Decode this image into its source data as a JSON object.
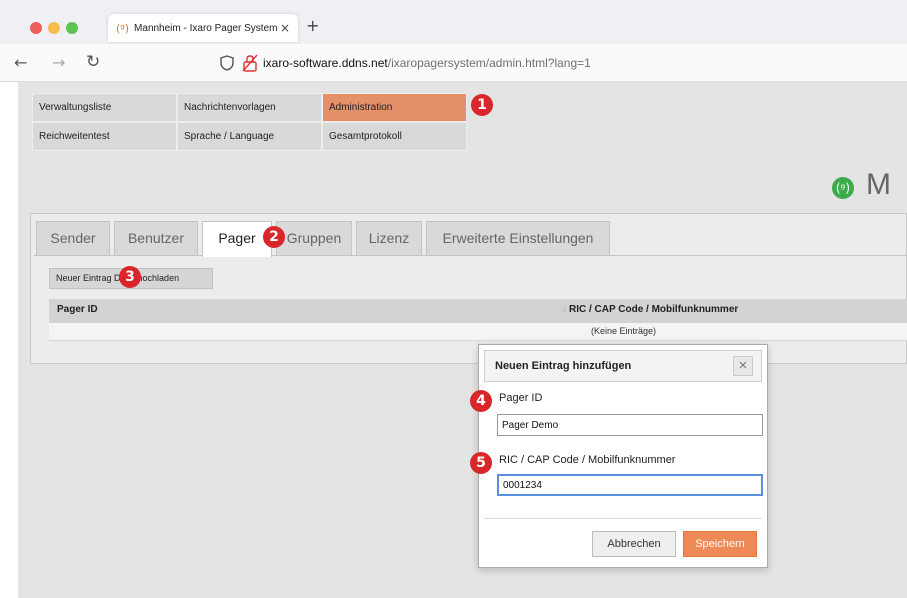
{
  "browser": {
    "tab_title": "Mannheim - Ixaro Pager System",
    "tab_icon": "(ᵍ)",
    "tab_close": "×",
    "new_tab": "+",
    "url_host": "ixaro-software.ddns.net",
    "url_path": "/ixaropagersystem/admin.html?lang=1",
    "back": "←",
    "forward": "→",
    "reload": "↻"
  },
  "menu": [
    {
      "label": "Verwaltungsliste"
    },
    {
      "label": "Nachrichtenvorlagen"
    },
    {
      "label": "Administration",
      "active": true
    },
    {
      "label": "Reichweitentest"
    },
    {
      "label": "Sprache / Language"
    },
    {
      "label": "Gesamtprotokoll"
    }
  ],
  "logo": {
    "icon": "(ᵍ)",
    "text": "M"
  },
  "subtabs": [
    {
      "label": "Sender"
    },
    {
      "label": "Benutzer"
    },
    {
      "label": "Pager",
      "active": true
    },
    {
      "label": "Gruppen"
    },
    {
      "label": "Lizenz"
    },
    {
      "label": "Erweiterte Einstellungen"
    }
  ],
  "toolbar": {
    "new_entry_label": "Neuer Eintrag Datei hochladen"
  },
  "table": {
    "columns": [
      "Pager ID",
      "RIC / CAP Code / Mobilfunknummer"
    ],
    "sort_indicator": "⇕",
    "empty_text": "(Keine Einträge)"
  },
  "dialog": {
    "title": "Neuen Eintrag hinzufügen",
    "close": "✕",
    "field1_label": "Pager ID",
    "field1_value": "Pager Demo",
    "field2_label": "RIC / CAP Code / Mobilfunknummer",
    "field2_value": "0001234",
    "cancel_label": "Abbrechen",
    "save_label": "Speichern"
  },
  "callouts": [
    "1",
    "2",
    "3",
    "4",
    "5"
  ],
  "colors": {
    "accent": "#e6906a",
    "save": "#ee8a55",
    "callout": "#d9262b"
  }
}
